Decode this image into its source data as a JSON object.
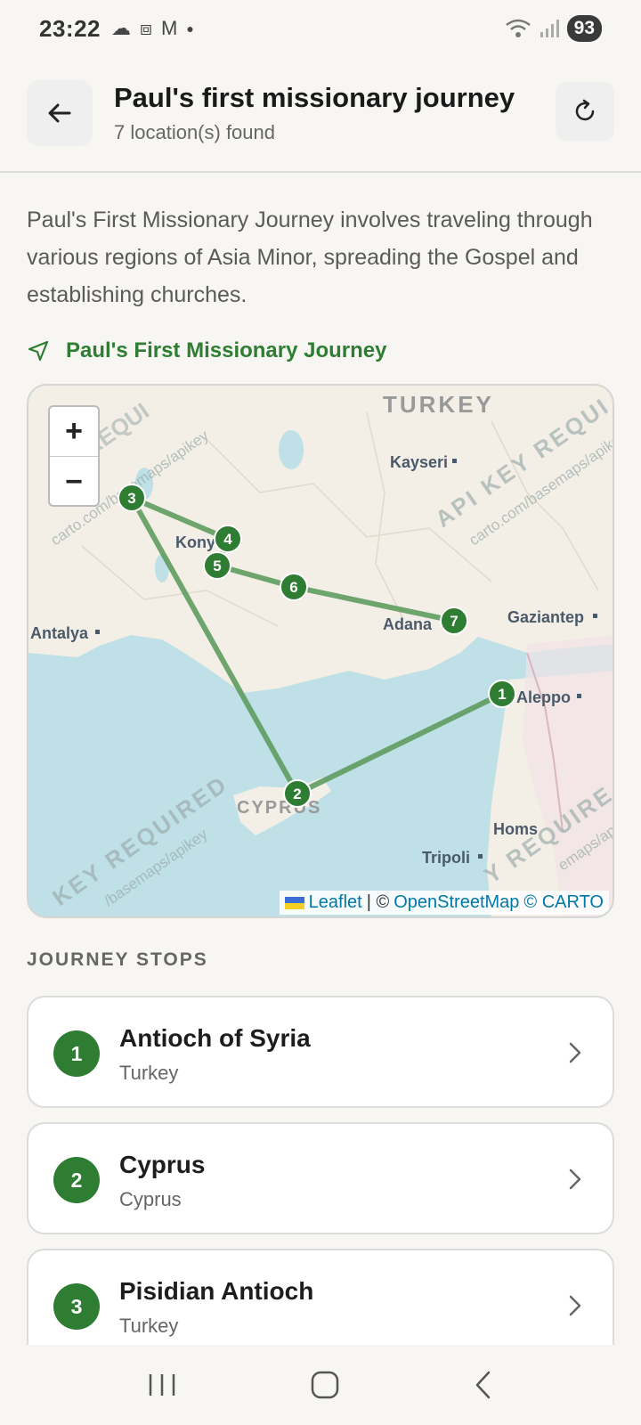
{
  "status": {
    "time": "23:22",
    "battery": "93"
  },
  "header": {
    "title": "Paul's first missionary journey",
    "subtitle": "7 location(s) found"
  },
  "description": "Paul's First Missionary Journey involves traveling through various regions of Asia Minor, spreading the Gospel and establishing churches.",
  "route": {
    "name": "Paul's First Missionary Journey",
    "color": "#2e7d32"
  },
  "map": {
    "zoom_in": "+",
    "zoom_out": "−",
    "labels": {
      "country": "TURKEY",
      "kayseri": "Kayseri",
      "konya": "Kony",
      "antalya": "Antalya",
      "adana": "Adana",
      "gaziantep": "Gaziantep",
      "aleppo": "Aleppo",
      "cyprus": "CYPRUS",
      "homs": "Homs",
      "tripoli": "Tripoli",
      "wm1": "API KEY REQUI",
      "wm2": "carto.com/basemaps/apikey",
      "wm3": "REQUI",
      "wm4": "carto.com/basemaps/apikey",
      "wm5": "KEY REQUIRED",
      "wm6": "/basemaps/apikey",
      "wm7": "Y REQUIRE",
      "wm8": "emaps/ap"
    },
    "markers": [
      "1",
      "2",
      "3",
      "4",
      "5",
      "6",
      "7"
    ],
    "attribution": {
      "leaflet": "Leaflet",
      "sep": "| ©",
      "osm": "OpenStreetMap",
      "carto": "© CARTO"
    }
  },
  "stops_heading": "JOURNEY STOPS",
  "stops": [
    {
      "num": "1",
      "name": "Antioch of Syria",
      "country": "Turkey"
    },
    {
      "num": "2",
      "name": "Cyprus",
      "country": "Cyprus"
    },
    {
      "num": "3",
      "name": "Pisidian Antioch",
      "country": "Turkey"
    }
  ]
}
